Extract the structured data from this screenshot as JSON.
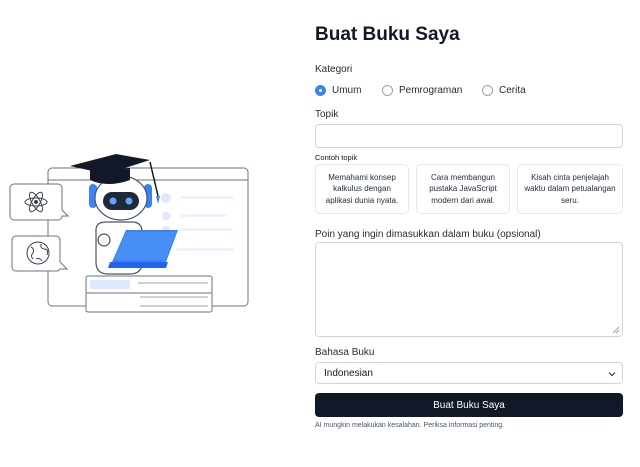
{
  "form": {
    "title": "Buat Buku Saya",
    "kategori_label": "Kategori",
    "kategori_options": [
      {
        "label": "Umum",
        "selected": true
      },
      {
        "label": "Pemrograman",
        "selected": false
      },
      {
        "label": "Cerita",
        "selected": false
      }
    ],
    "topik_label": "Topik",
    "topik_value": "",
    "contoh_label": "Contoh topik",
    "contoh": [
      "Memahami konsep kalkulus dengan aplikasi dunia nyata.",
      "Cara membangun pustaka JavaScript modern dari awal.",
      "Kisah cinta penjelajah waktu dalam petualangan seru."
    ],
    "poin_label": "Poin yang ingin dimasukkan dalam buku (opsional)",
    "poin_value": "",
    "bahasa_label": "Bahasa Buku",
    "bahasa_value": "Indonesian",
    "submit_label": "Buat Buku Saya",
    "disclaimer": "AI mungkin melakukan kesalahan. Periksa informasi penting."
  },
  "colors": {
    "accent": "#3b82f6",
    "button_bg": "#111827",
    "laptop": "#3b82f6"
  },
  "icons": [
    "atom-icon",
    "globe-icon",
    "graduation-cap-icon",
    "robot-icon",
    "laptop-icon",
    "chevron-down-icon"
  ]
}
